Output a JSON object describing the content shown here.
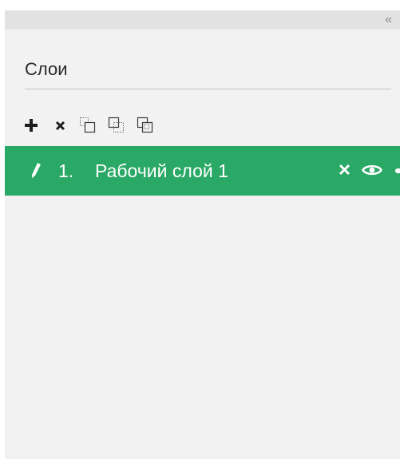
{
  "panel": {
    "collapse_glyph": "«",
    "collapse_icon": "double-chevron-left-icon",
    "title": "Слои"
  },
  "toolbar": {
    "items": [
      {
        "name": "add-layer-button",
        "icon": "plus-icon"
      },
      {
        "name": "delete-layer-button",
        "icon": "cross-icon"
      },
      {
        "name": "copy-layer-button-1",
        "icon": "copy-dotted-icon"
      },
      {
        "name": "copy-layer-button-2",
        "icon": "copy-dotted-icon"
      },
      {
        "name": "copy-layer-button-3",
        "icon": "copy-dotted-icon"
      }
    ]
  },
  "layers": [
    {
      "index": "1.",
      "name": "Рабочий слой 1",
      "selected": true,
      "edit_icon": "pencil-icon",
      "close_icon": "close-icon",
      "visibility_icon": "eye-icon"
    }
  ],
  "colors": {
    "panel_bg": "#f2f2f2",
    "topbar_bg": "#e2e2e2",
    "selected_row": "#2aa865",
    "text": "#2a2a2a"
  }
}
